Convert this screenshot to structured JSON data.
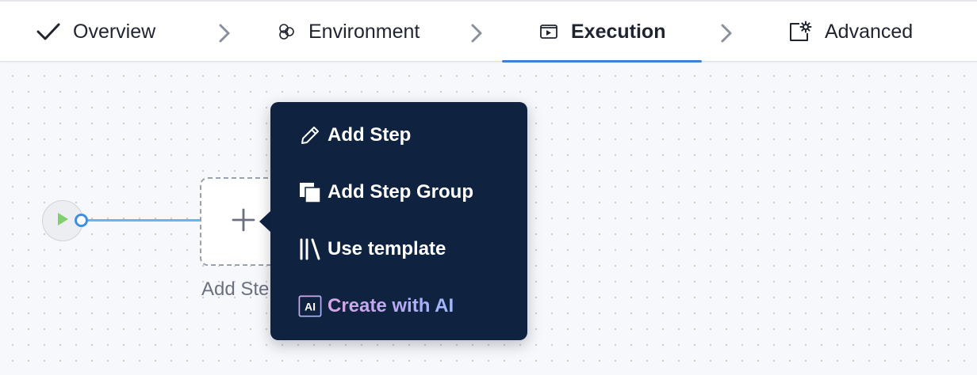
{
  "tabs": [
    {
      "label": "Overview",
      "icon": "check-icon",
      "active": false
    },
    {
      "label": "Environment",
      "icon": "environment-icon",
      "active": false
    },
    {
      "label": "Execution",
      "icon": "execution-icon",
      "active": true
    },
    {
      "label": "Advanced",
      "icon": "advanced-gear-icon",
      "active": false
    }
  ],
  "canvas": {
    "add_step_label": "Add Step"
  },
  "menu": {
    "items": [
      {
        "label": "Add Step",
        "icon": "pencil-icon"
      },
      {
        "label": "Add Step Group",
        "icon": "step-group-icon"
      },
      {
        "label": "Use template",
        "icon": "template-library-icon"
      },
      {
        "label": "Create with AI",
        "icon": "ai-icon",
        "icon_text": "AI"
      }
    ]
  },
  "colors": {
    "accent": "#3b82d6",
    "menu_bg": "#0f2240",
    "connector": "#66b5f0",
    "start_play": "#7fd06a"
  }
}
